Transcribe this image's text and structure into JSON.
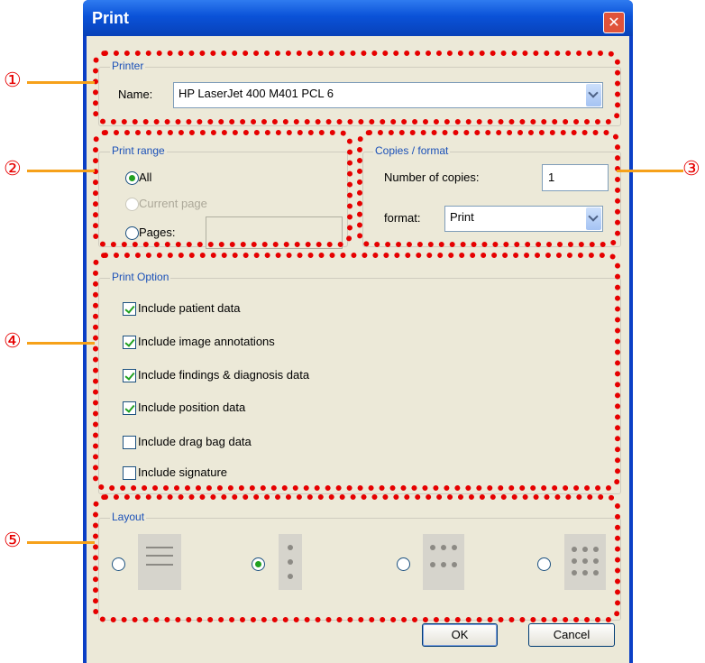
{
  "window": {
    "title": "Print",
    "close_glyph": "✕"
  },
  "printer": {
    "legend": "Printer",
    "name_label": "Name:",
    "name_value": "HP LaserJet 400 M401 PCL 6"
  },
  "print_range": {
    "legend": "Print range",
    "all_label": "All",
    "current_page_label": "Current page",
    "pages_label": "Pages:",
    "pages_value": "",
    "selected": "All"
  },
  "copies_format": {
    "legend": "Copies / format",
    "copies_label": "Number of copies:",
    "copies_value": "1",
    "format_label": "format:",
    "format_value": "Print"
  },
  "print_option": {
    "legend": "Print Option",
    "items": [
      {
        "label": "Include patient data",
        "checked": true
      },
      {
        "label": "Include image annotations",
        "checked": true
      },
      {
        "label": "Include findings & diagnosis data",
        "checked": true
      },
      {
        "label": "Include position data",
        "checked": true
      },
      {
        "label": "Include drag bag data",
        "checked": false
      },
      {
        "label": "Include signature",
        "checked": false
      }
    ]
  },
  "layout": {
    "legend": "Layout",
    "options": [
      {
        "icon": "three-lines-layout-icon",
        "selected": false
      },
      {
        "icon": "three-dots-layout-icon",
        "selected": true
      },
      {
        "icon": "six-dots-layout-icon",
        "selected": false
      },
      {
        "icon": "nine-dots-layout-icon",
        "selected": false
      }
    ]
  },
  "buttons": {
    "ok": "OK",
    "cancel": "Cancel"
  },
  "callouts": [
    "①",
    "②",
    "③",
    "④",
    "⑤"
  ],
  "colors": {
    "annotation_red": "#e60000",
    "leader_orange": "#f6a11a",
    "titlebar_blue": "#0a52d8"
  }
}
